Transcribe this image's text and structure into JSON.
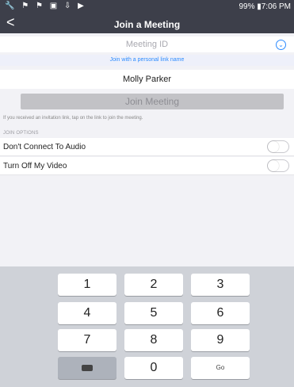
{
  "status_bar": {
    "left_icons": "🔧 ⚑ ⚑ ▣ ⇩ ▶",
    "right_text": "99% ▮7:06 PM"
  },
  "header": {
    "back_label": "<",
    "title": "Join a Meeting"
  },
  "meeting_id": {
    "placeholder": "Meeting ID",
    "dropdown_icon": "chevron-down-circle-icon"
  },
  "personal_link": "Join with a personal link name",
  "name_field": {
    "value": "Molly Parker"
  },
  "join_button": {
    "label": "Join Meeting"
  },
  "hint": "If you received an invitation link, tap on the link to join the meeting.",
  "join_options": {
    "header": "JOIN OPTIONS",
    "items": [
      {
        "label": "Don't Connect To Audio",
        "on": false
      },
      {
        "label": "Turn Off My Video",
        "on": false
      }
    ]
  },
  "keypad": {
    "keys": [
      "1",
      "2",
      "3",
      "4",
      "5",
      "6",
      "7",
      "8",
      "9",
      "",
      "0",
      "Go"
    ],
    "backspace_icon": "backspace-icon"
  },
  "colors": {
    "accent": "#2d8cff",
    "header_bg": "#3d3f4a"
  }
}
